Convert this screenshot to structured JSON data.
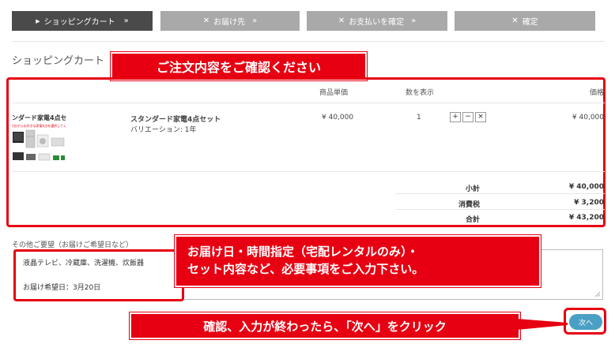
{
  "steps": [
    {
      "icon": "▶",
      "label": "ショッピングカート",
      "arrow": "»"
    },
    {
      "icon": "✕",
      "label": "お届け先",
      "arrow": "»"
    },
    {
      "icon": "✕",
      "label": "お支払いを確定",
      "arrow": "»"
    },
    {
      "icon": "✕",
      "label": "確定",
      "arrow": ""
    }
  ],
  "page_title": "ショッピングカート",
  "callouts": {
    "confirm": "ご注文内容をご確認ください",
    "remarks_line1": "お届け日・時間指定（宅配レンタルのみ）・",
    "remarks_line2": "セット内容など、必要事項をご入力下さい。",
    "next": "確認、入力が終わったら、「次へ」をクリック"
  },
  "cart": {
    "headers": {
      "unit_price": "商品単価",
      "qty": "数を表示",
      "price": "価格"
    },
    "item": {
      "image_caption": "ンダード家電4点セ",
      "image_subcaption": "1台からお好きな家電4点を選択してください",
      "name": "スタンダード家電4点セット",
      "variation": "バリエーション: 1年",
      "unit_price": "¥ 40,000",
      "qty": "1",
      "price": "¥ 40,000",
      "controls": [
        "+",
        "−",
        "×"
      ]
    },
    "summary": [
      {
        "label": "小計",
        "value": "¥ 40,000"
      },
      {
        "label": "消費税",
        "value": "¥ 3,200"
      },
      {
        "label": "合計",
        "value": "¥ 43,200"
      }
    ]
  },
  "remarks": {
    "label": "その他ご要望（お届けご希望日など）",
    "line1": "液晶テレビ、冷蔵庫、洗濯機、炊飯器",
    "line2": "お届け希望日：3月20日"
  },
  "next_button": "次へ",
  "colors": {
    "accent_red": "#e60012",
    "step_active": "#4a4a4a",
    "step_inactive": "#a9a9a9",
    "next_button": "#4a9fc4"
  }
}
